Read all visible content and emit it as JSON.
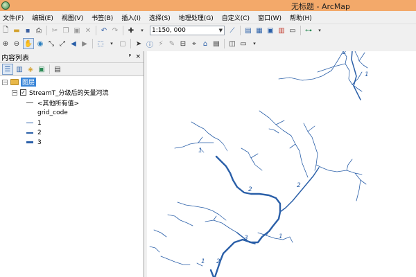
{
  "window": {
    "title": "无标题 - ArcMap"
  },
  "menu": [
    "文件(F)",
    "编辑(E)",
    "视图(V)",
    "书签(B)",
    "插入(I)",
    "选择(S)",
    "地理处理(G)",
    "自定义(C)",
    "窗口(W)",
    "帮助(H)"
  ],
  "toolbar": {
    "scale": "1:150, 000"
  },
  "toc": {
    "title": "内容列表",
    "layers_group": "图层",
    "layer_name": "StreamT_分级后的矢量河流",
    "other_values": "<其他所有值>",
    "field": "grid_code",
    "classes": [
      "1",
      "2",
      "3"
    ]
  },
  "colors": {
    "titlebar": "#f3a96a",
    "stream": "#2a5fa8",
    "selection": "#3a86d8"
  },
  "map": {
    "labels": [
      "1",
      "1",
      "2",
      "2",
      "1",
      "2",
      "3",
      "1",
      "2"
    ]
  }
}
